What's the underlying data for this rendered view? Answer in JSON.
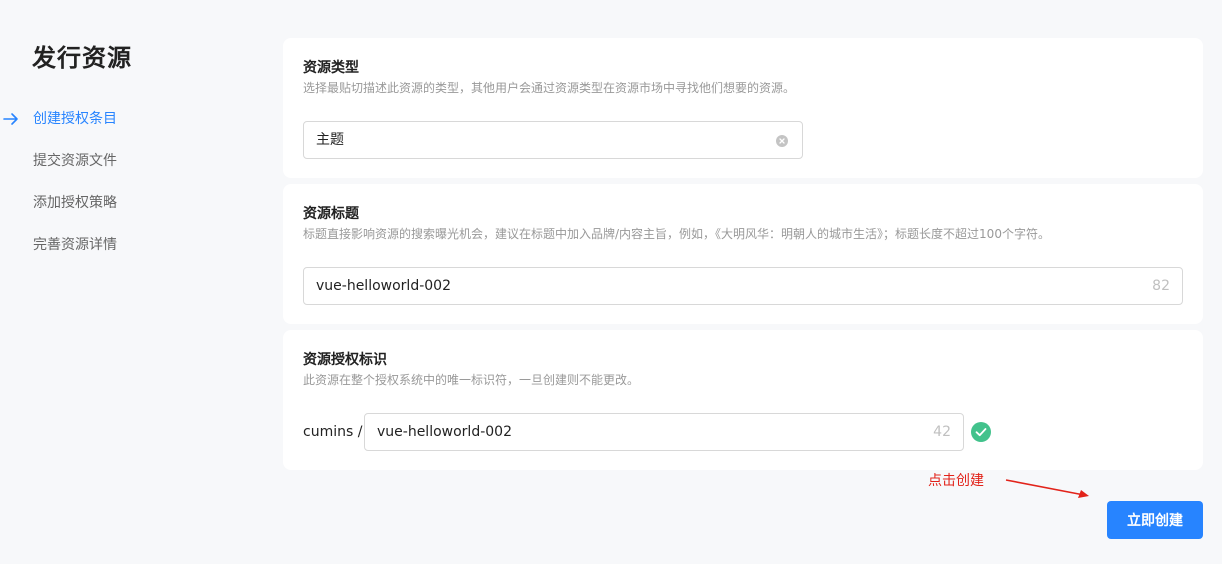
{
  "sidebar": {
    "title": "发行资源",
    "steps": [
      {
        "label": "创建授权条目",
        "active": true
      },
      {
        "label": "提交资源文件",
        "active": false
      },
      {
        "label": "添加授权策略",
        "active": false
      },
      {
        "label": "完善资源详情",
        "active": false
      }
    ]
  },
  "resource_type": {
    "title": "资源类型",
    "description": "选择最贴切描述此资源的类型，其他用户会通过资源类型在资源市场中寻找他们想要的资源。",
    "value": "主题"
  },
  "resource_title": {
    "title": "资源标题",
    "description": "标题直接影响资源的搜索曝光机会，建议在标题中加入品牌/内容主旨，例如，《大明风华：明朝人的城市生活》；标题长度不超过100个字符。",
    "value": "vue-helloworld-002",
    "remaining": "82"
  },
  "resource_identifier": {
    "title": "资源授权标识",
    "description": "此资源在整个授权系统中的唯一标识符，一旦创建则不能更改。",
    "prefix": "cumins /",
    "value": "vue-helloworld-002",
    "remaining": "42"
  },
  "annotation": {
    "text": "点击创建"
  },
  "actions": {
    "create_label": "立即创建"
  },
  "colors": {
    "accent": "#2784ff",
    "success": "#42c28c",
    "annotation": "#e2231a",
    "background": "#f7f8fa"
  },
  "icons": {
    "active_step": "arrow-right-icon",
    "clear": "clear-circle-icon",
    "valid": "check-circle-icon"
  }
}
